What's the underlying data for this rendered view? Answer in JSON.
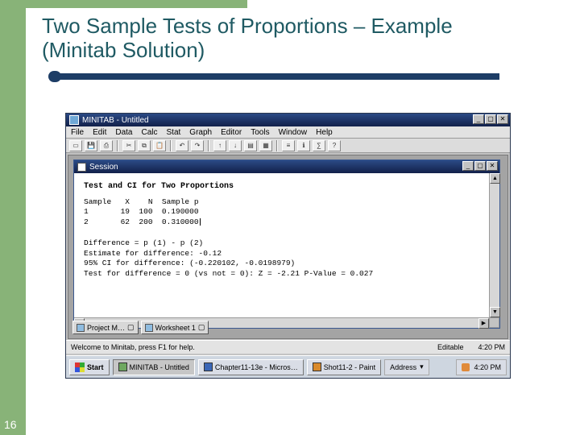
{
  "slide": {
    "title": "Two Sample Tests of Proportions – Example (Minitab Solution)",
    "page_number": "16"
  },
  "app": {
    "title": "MINITAB - Untitled",
    "menu": [
      "File",
      "Edit",
      "Data",
      "Calc",
      "Stat",
      "Graph",
      "Editor",
      "Tools",
      "Window",
      "Help"
    ],
    "session_title": "Session",
    "output": {
      "heading": "Test and CI for Two Proportions",
      "table_header": "Sample   X    N  Sample p",
      "row1": "1       19  100  0.190000",
      "row2": "2       62  200  0.310000",
      "diff_line": "Difference = p (1) - p (2)",
      "est_line": "Estimate for difference:  -0.12",
      "ci_line": "95% CI for difference: (-0.220102, -0.0198979)",
      "test_line": "Test for difference = 0 (vs not = 0):  Z = -2.21  P-Value = 0.027"
    },
    "minimized": {
      "project": "Project M…",
      "worksheet": "Worksheet 1"
    },
    "status": {
      "help": "Welcome to Minitab, press F1 for help.",
      "mode": "Editable",
      "time": "4:20 PM"
    },
    "taskbar": {
      "start": "Start",
      "t1": "MINITAB - Untitled",
      "t2": "Chapter11-13e - Micros…",
      "t3": "Shot11-2 - Paint",
      "address_label": "Address",
      "tray_time": "4:20 PM"
    }
  }
}
